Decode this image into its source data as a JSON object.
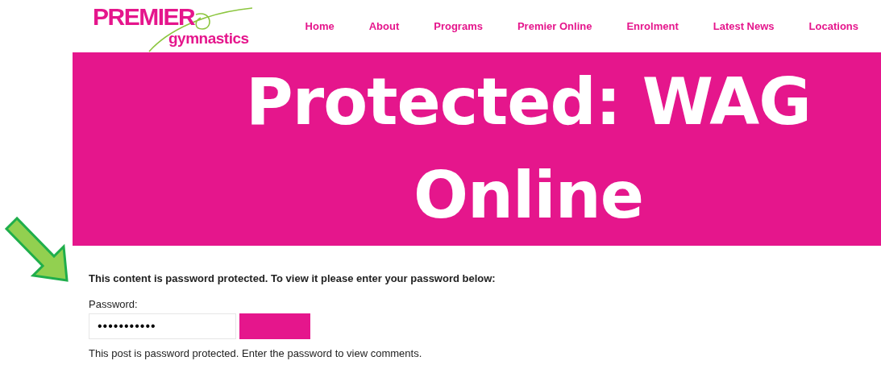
{
  "logo": {
    "line_1": "PREMIER",
    "line_2": "gymnastics"
  },
  "nav": [
    {
      "label": "Home"
    },
    {
      "label": "About"
    },
    {
      "label": "Programs"
    },
    {
      "label": "Premier Online"
    },
    {
      "label": "Enrolment"
    },
    {
      "label": "Latest News"
    },
    {
      "label": "Locations"
    }
  ],
  "title": "Protected: WAG Online",
  "notice": "This content is password protected. To view it please enter your password below:",
  "password": {
    "label": "Password:",
    "value": "•••••••••••"
  },
  "comments_note": "This post is password protected. Enter the password to view comments."
}
